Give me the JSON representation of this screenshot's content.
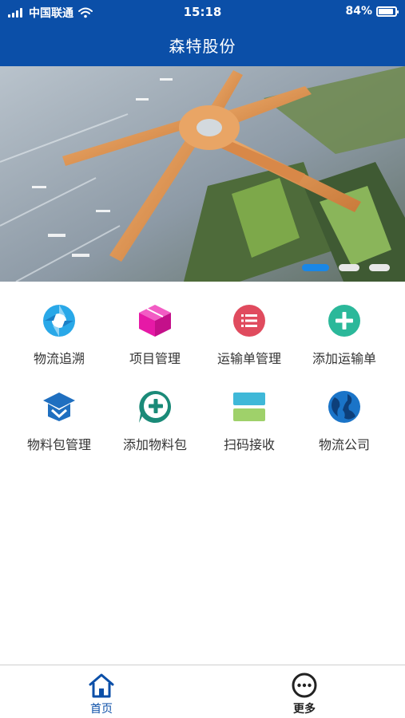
{
  "status_bar": {
    "carrier": "中国联通",
    "time": "15:18",
    "battery": "84%"
  },
  "nav": {
    "title": "森特股份"
  },
  "banner": {
    "slide_count": 3,
    "active_index": 0
  },
  "menu": [
    {
      "label": "物流追溯",
      "icon": "aperture-icon",
      "color": "#29a8e8"
    },
    {
      "label": "项目管理",
      "icon": "cube-icon",
      "color": "#e619a6"
    },
    {
      "label": "运输单管理",
      "icon": "list-icon",
      "color": "#e04b5e"
    },
    {
      "label": "添加运输单",
      "icon": "plus-circle-icon",
      "color": "#2bb89a"
    },
    {
      "label": "物料包管理",
      "icon": "graduation-cap-icon",
      "color": "#1f6fc0"
    },
    {
      "label": "添加物料包",
      "icon": "add-chat-icon",
      "color": "#1a8a78"
    },
    {
      "label": "扫码接收",
      "icon": "scan-card-icon",
      "color": "#3fb8d8"
    },
    {
      "label": "物流公司",
      "icon": "globe-icon",
      "color": "#1a74c8"
    }
  ],
  "tabbar": {
    "home_label": "首页",
    "more_label": "更多",
    "active_color": "#0b4fa8"
  }
}
